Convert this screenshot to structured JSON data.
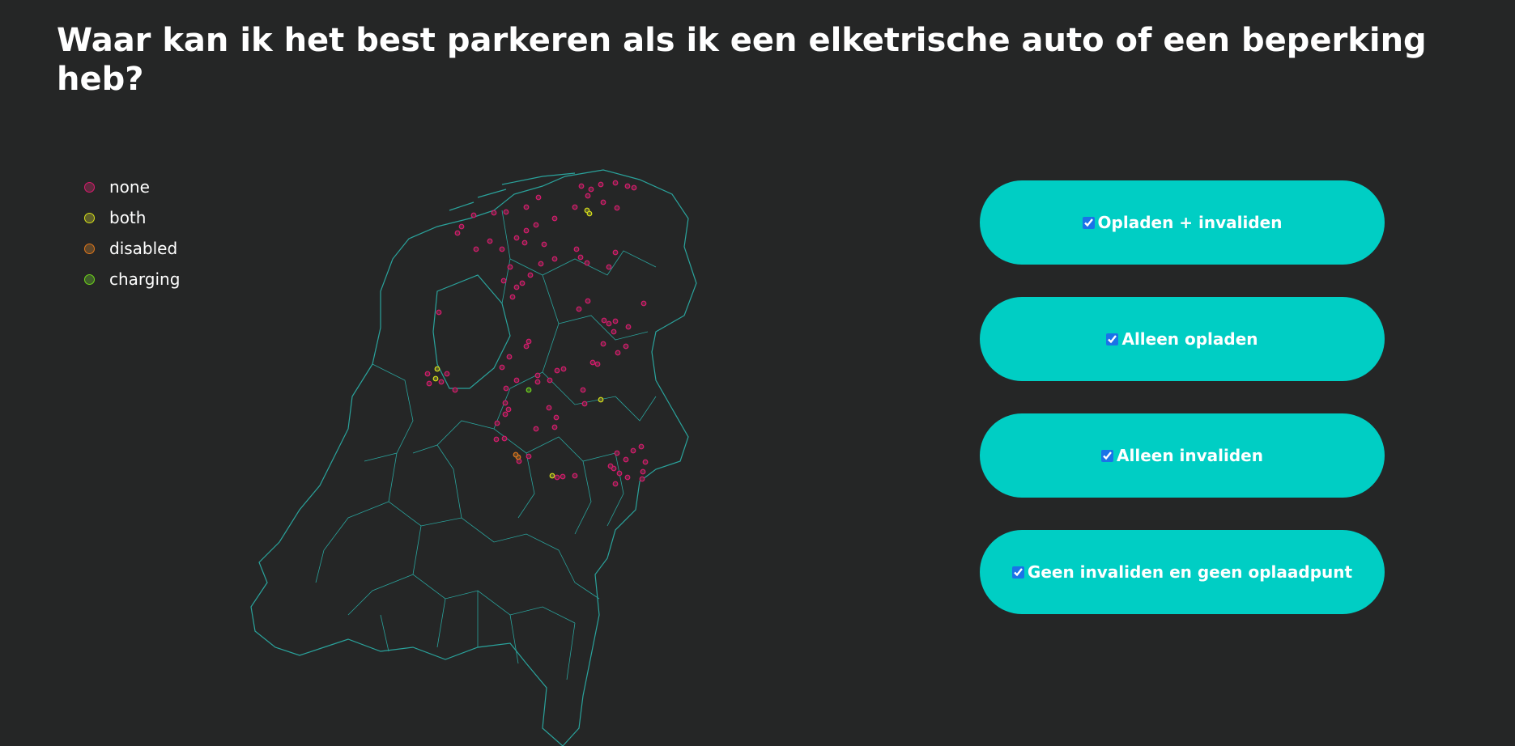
{
  "page": {
    "title": "Waar kan ik het best parkeren als ik een elketrische auto of een beperking heb?"
  },
  "legend": [
    {
      "label": "none",
      "color": "#d91a6e",
      "fill": "#5e2a3e"
    },
    {
      "label": "both",
      "color": "#d6e01a",
      "fill": "#5e5f2a"
    },
    {
      "label": "disabled",
      "color": "#e0761a",
      "fill": "#5e462a"
    },
    {
      "label": "charging",
      "color": "#6fd61a",
      "fill": "#3f5e2a"
    }
  ],
  "filters": [
    {
      "label": "Opladen + invaliden",
      "checked": true
    },
    {
      "label": "Alleen opladen",
      "checked": true
    },
    {
      "label": "Alleen invaliden",
      "checked": true
    },
    {
      "label": "Geen invaliden en geen oplaadpunt",
      "checked": true
    }
  ],
  "map": {
    "outline_color": "#2aa39c"
  }
}
